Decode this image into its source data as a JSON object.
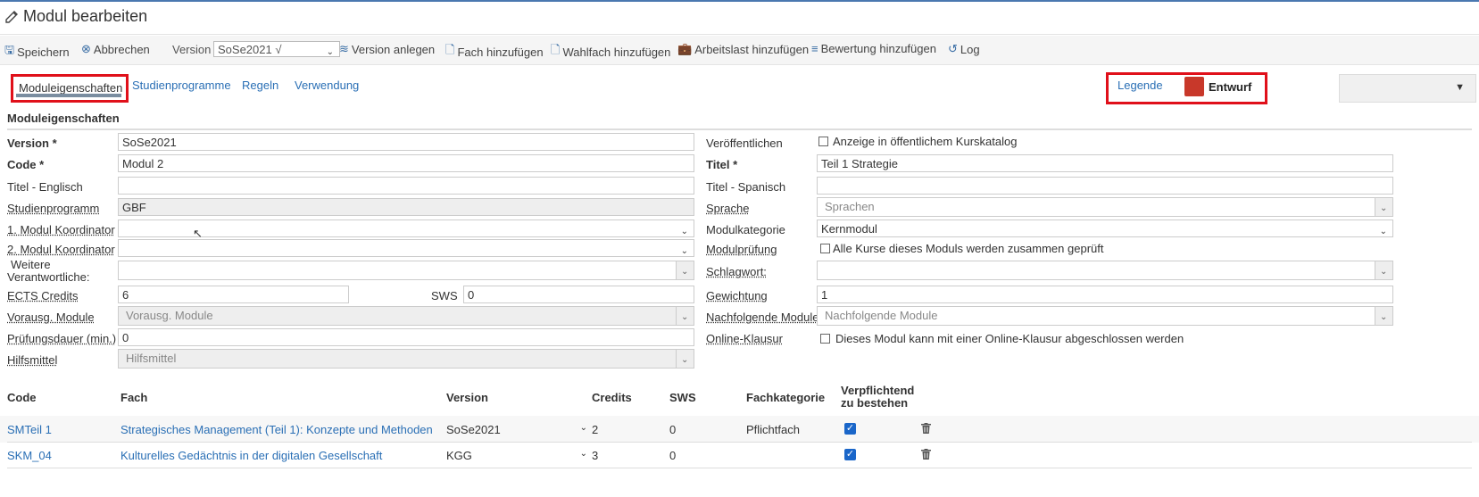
{
  "page": {
    "title": "Modul bearbeiten"
  },
  "toolbar": {
    "save": "Speichern",
    "cancel": "Abbrechen",
    "version_label": "Version",
    "version_value": "SoSe2021 √",
    "create_version": "Version anlegen",
    "add_subject": "Fach hinzufügen",
    "add_elective": "Wahlfach hinzufügen",
    "add_workload": "Arbeitslast hinzufügen",
    "add_rating": "Bewertung hinzufügen",
    "log": "Log"
  },
  "tabs": [
    "Moduleigenschaften",
    "Studienprogramme",
    "Regeln",
    "Verwendung"
  ],
  "legend": {
    "label": "Legende",
    "status": "Entwurf",
    "status_color": "#c8382a"
  },
  "section_title": "Moduleigenschaften",
  "left_fields": {
    "version": {
      "label": "Version *",
      "value": "SoSe2021"
    },
    "code": {
      "label": "Code *",
      "value": "Modul 2"
    },
    "title_en": {
      "label": "Titel - Englisch",
      "value": ""
    },
    "program": {
      "label": "Studienprogramm",
      "value": "GBF"
    },
    "coord1": {
      "label": "1. Modul Koordinator",
      "value": ""
    },
    "coord2": {
      "label": "2. Modul Koordinator",
      "value": ""
    },
    "responsible": {
      "label": "Weitere Verantwortliche:",
      "value": ""
    },
    "ects": {
      "label": "ECTS Credits",
      "value": "6"
    },
    "sws": {
      "label": "SWS",
      "value": "0"
    },
    "prereq": {
      "label": "Vorausg. Module",
      "placeholder": "Vorausg. Module"
    },
    "duration": {
      "label": "Prüfungsdauer (min.)",
      "value": "0"
    },
    "aids": {
      "label": "Hilfsmittel",
      "placeholder": "Hilfsmittel"
    }
  },
  "right_fields": {
    "publish": {
      "label": "Veröffentlichen",
      "checkbox": "Anzeige in öffentlichem Kurskatalog"
    },
    "title": {
      "label": "Titel *",
      "value": "Teil 1 Strategie"
    },
    "title_es": {
      "label": "Titel - Spanisch",
      "value": ""
    },
    "language": {
      "label": "Sprache",
      "placeholder": "Sprachen"
    },
    "category": {
      "label": "Modulkategorie",
      "value": "Kernmodul"
    },
    "exam": {
      "label": "Modulprüfung",
      "checkbox": "Alle Kurse dieses Moduls werden zusammen geprüft"
    },
    "keyword": {
      "label": "Schlagwort:",
      "value": ""
    },
    "weight": {
      "label": "Gewichtung",
      "value": "1"
    },
    "following": {
      "label": "Nachfolgende Module",
      "placeholder": "Nachfolgende Module"
    },
    "online": {
      "label": "Online-Klausur",
      "checkbox": "Dieses Modul kann mit einer Online-Klausur abgeschlossen werden"
    }
  },
  "table": {
    "headers": {
      "code": "Code",
      "fach": "Fach",
      "version": "Version",
      "credits": "Credits",
      "sws": "SWS",
      "category": "Fachkategorie",
      "mandatory_1": "Verpflichtend",
      "mandatory_2": "zu bestehen"
    },
    "rows": [
      {
        "code": "SMTeil 1",
        "fach": "Strategisches Management (Teil 1): Konzepte und Methoden",
        "version": "SoSe2021",
        "credits": "2",
        "sws": "0",
        "category": "Pflichtfach"
      },
      {
        "code": "SKM_04",
        "fach": "Kulturelles Gedächtnis in der digitalen Gesellschaft",
        "version": "KGG",
        "credits": "3",
        "sws": "0",
        "category": ""
      }
    ]
  }
}
